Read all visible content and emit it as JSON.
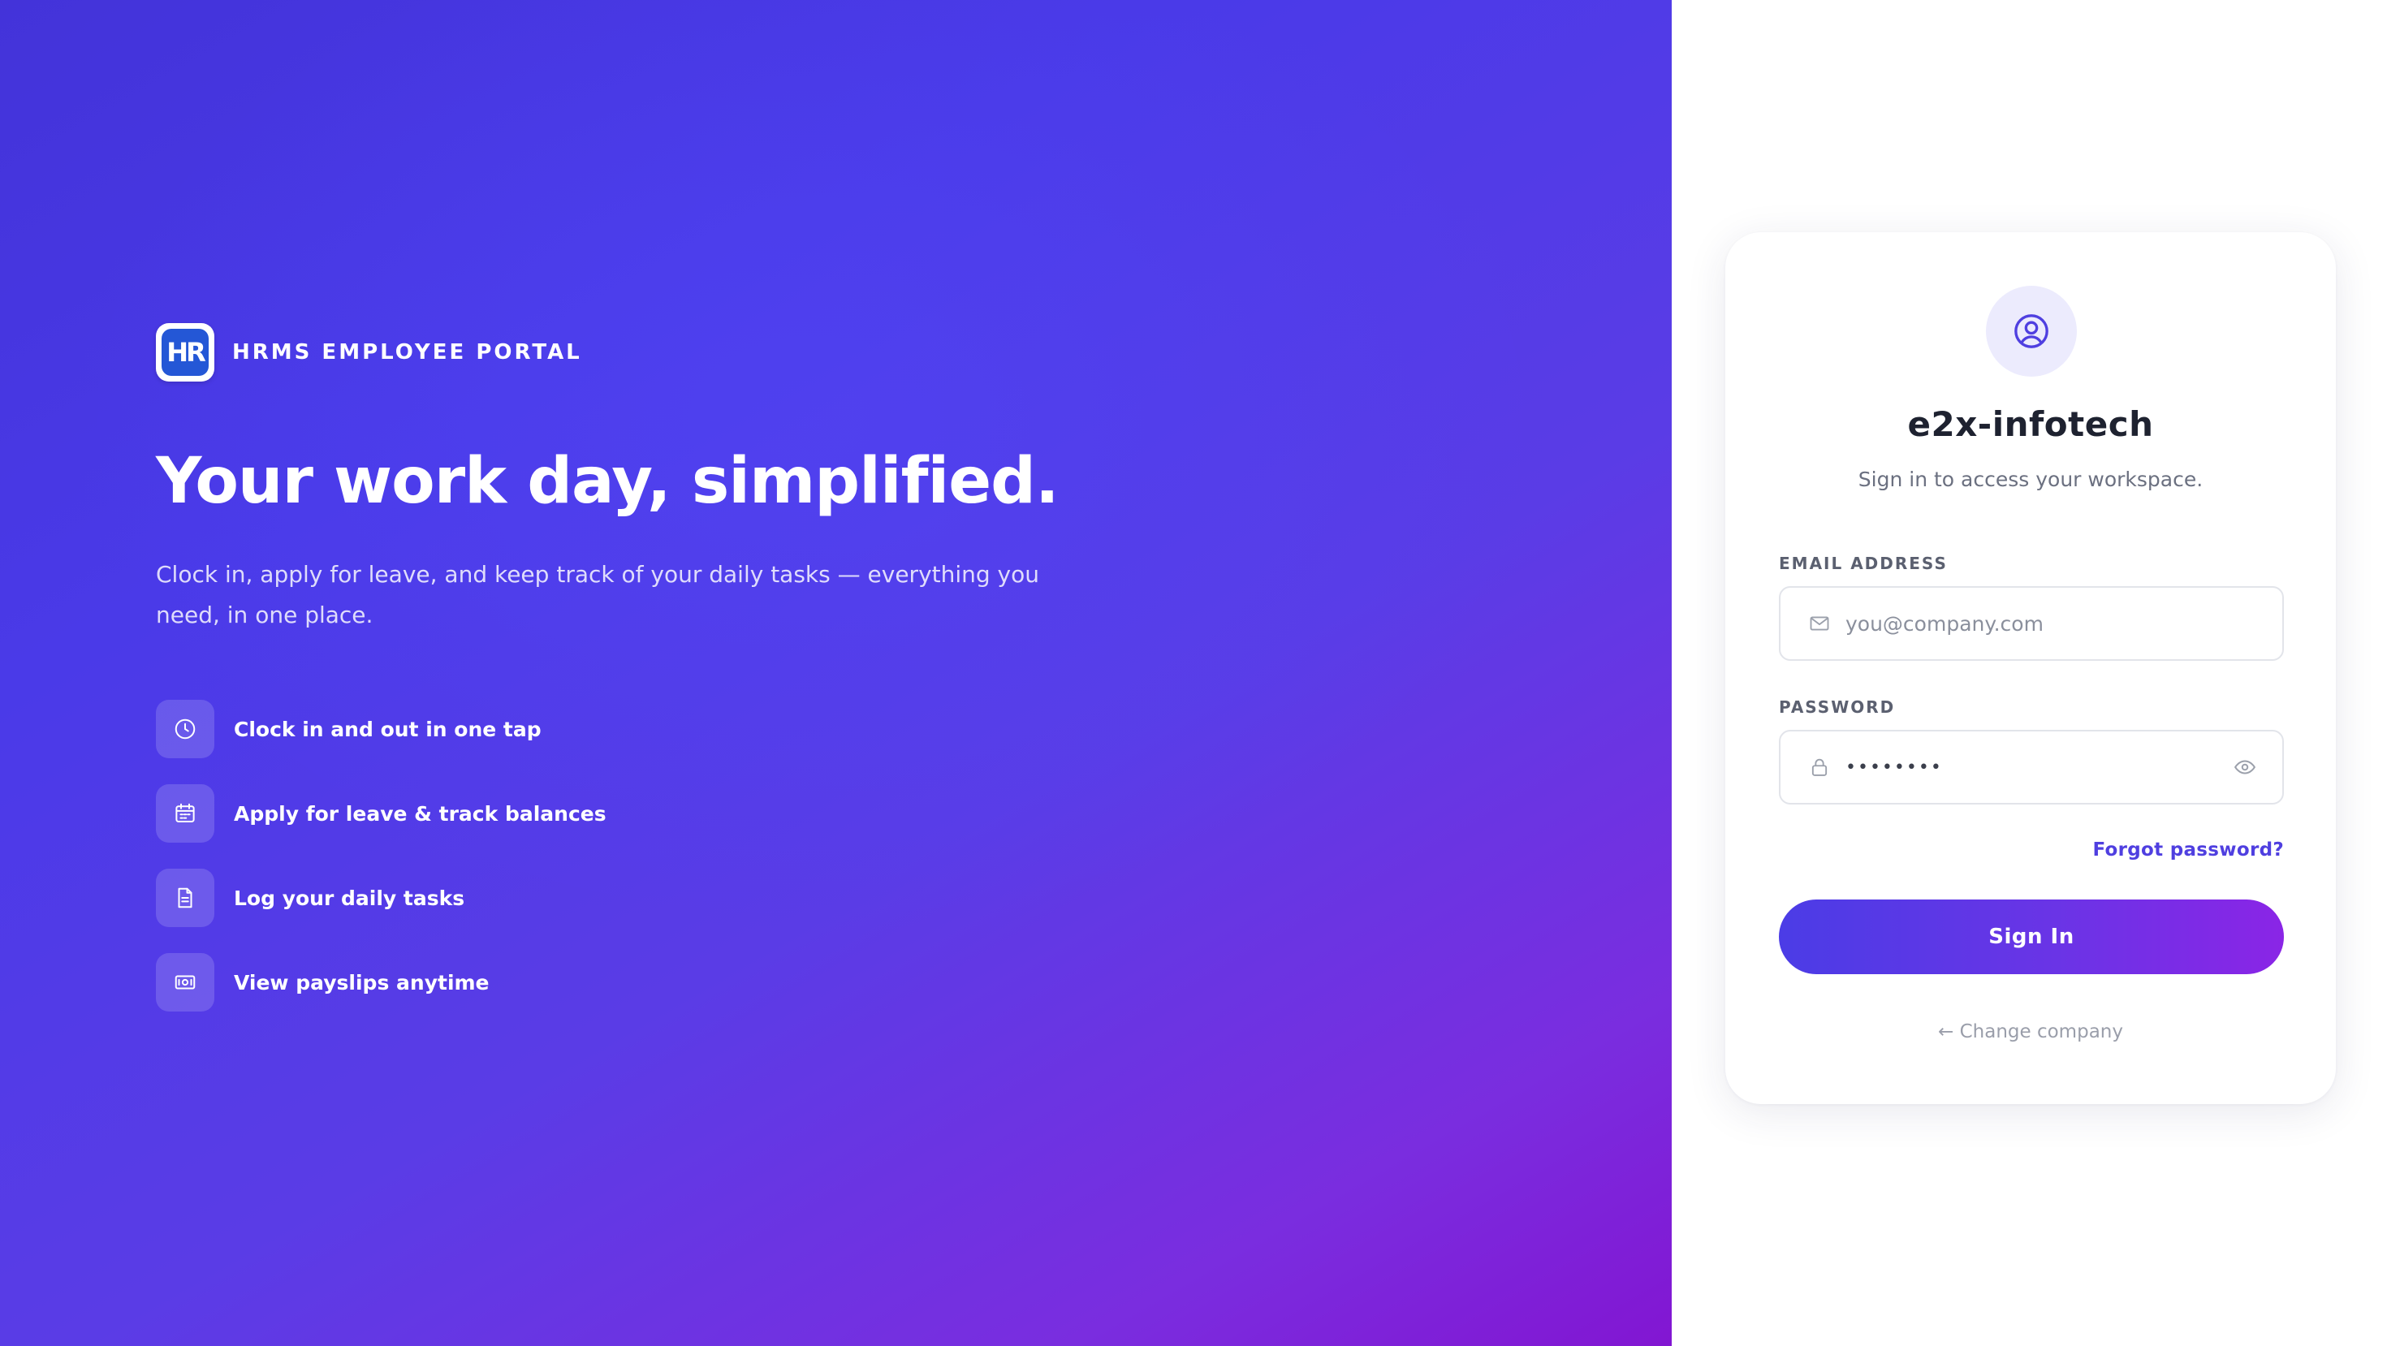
{
  "brand": {
    "logo_text": "HR",
    "name": "HRMS EMPLOYEE PORTAL"
  },
  "hero": {
    "headline": "Your work day, simplified.",
    "subtext": "Clock in, apply for leave, and keep track of your daily tasks — everything you need, in one place.",
    "features": [
      {
        "icon": "clock-icon",
        "label": "Clock in and out in one tap"
      },
      {
        "icon": "calendar-icon",
        "label": "Apply for leave & track balances"
      },
      {
        "icon": "document-icon",
        "label": "Log your daily tasks"
      },
      {
        "icon": "payslip-icon",
        "label": "View payslips anytime"
      }
    ]
  },
  "login": {
    "avatar_icon": "user-circle-icon",
    "company": "e2x-infotech",
    "subtitle": "Sign in to access your workspace.",
    "email": {
      "label": "EMAIL ADDRESS",
      "placeholder": "you@company.com",
      "value": ""
    },
    "password": {
      "label": "PASSWORD",
      "masked_value": "••••••••"
    },
    "forgot_label": "Forgot password?",
    "signin_label": "Sign In",
    "change_company_label": "← Change company"
  },
  "colors": {
    "accent": "#4f3fe0",
    "gradient_start": "#4333d9",
    "gradient_end": "#8216d2"
  }
}
